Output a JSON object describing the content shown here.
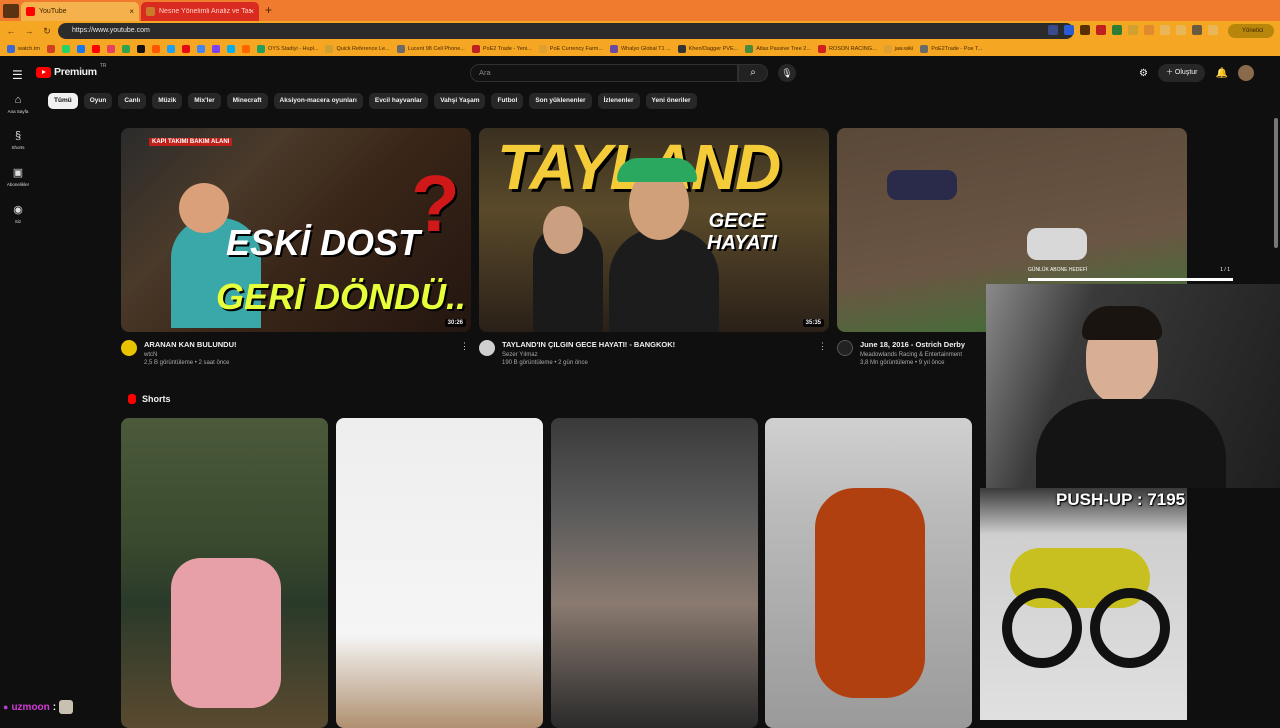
{
  "browser": {
    "tabs": [
      {
        "title": "YouTube",
        "active": true
      },
      {
        "title": "Nesne Yönelimli Analiz ve Tasarım",
        "active": false
      }
    ],
    "url": "https://www.youtube.com",
    "profile_label": "Yönetici",
    "bookmarks": [
      "watch.tm",
      "",
      "",
      "",
      "",
      "",
      "",
      "",
      "",
      "",
      "",
      "",
      "",
      "",
      "",
      "OYS Stadiyi - Hupl...",
      "Quick Reference Le...",
      "Lucent 98 Cell Phone...",
      "PoE2 Trade - Yeni...",
      "PoE Currency Farm...",
      "Whalyo Global T1 ...",
      "Khen/Dagger PVE...",
      "Atlas Passive Tree 2...",
      "ROSON RACING...",
      "jaw.wiki",
      "PoE2Trade - Poe T..."
    ]
  },
  "youtube": {
    "logo_text": "Premium",
    "region": "TR",
    "search_placeholder": "Ara",
    "create_label": "Oluştur",
    "sidebar": [
      {
        "label": "Ana Sayfa",
        "icon": "home-icon"
      },
      {
        "label": "Shorts",
        "icon": "shorts-icon"
      },
      {
        "label": "Abonelikler",
        "icon": "subscriptions-icon"
      },
      {
        "label": "Siz",
        "icon": "you-icon"
      }
    ],
    "chips": [
      "Tümü",
      "Oyun",
      "Canlı",
      "Müzik",
      "Mix'ler",
      "Minecraft",
      "Aksiyon-macera oyunları",
      "Evcil hayvanlar",
      "Vahşi Yaşam",
      "Futbol",
      "Son yüklenenler",
      "İzlenenler",
      "Yeni öneriler"
    ],
    "videos": [
      {
        "title": "ARANAN KAN BULUNDU!",
        "channel": "wtcN",
        "stats": "2,5 B görüntüleme • 2 saat önce",
        "duration": "30:26",
        "thumb_top": "KAPI TAKIMI BAKIM ALANI",
        "thumb_text1": "ESKİ DOST",
        "thumb_text2": "GERİ DÖNDÜ..",
        "thumb_q": "?"
      },
      {
        "title": "TAYLAND'IN ÇILGIN GECE HAYATI! - BANGKOK!",
        "channel": "Sezer Yılmaz",
        "stats": "190 B görüntüleme • 2 gün önce",
        "duration": "35:35",
        "thumb_text1": "TAYLAND",
        "thumb_text2": "GECE HAYATI"
      },
      {
        "title": "June 18, 2016 - Ostrich Derby",
        "channel": "Meadowlands Racing & Entertainment",
        "stats": "3,8 Mn görüntüleme • 9 yıl önce"
      }
    ],
    "shorts_heading": "Shorts"
  },
  "stream": {
    "pushup_label": "PUSH-UP : 7195",
    "sub_goal_label": "GÜNLÜK ABONE HEDEFİ",
    "sub_goal_count": "1 / 1",
    "sub_goal_progress": 1.0,
    "chat_user": "uzmoon",
    "chat_sep": ":"
  }
}
